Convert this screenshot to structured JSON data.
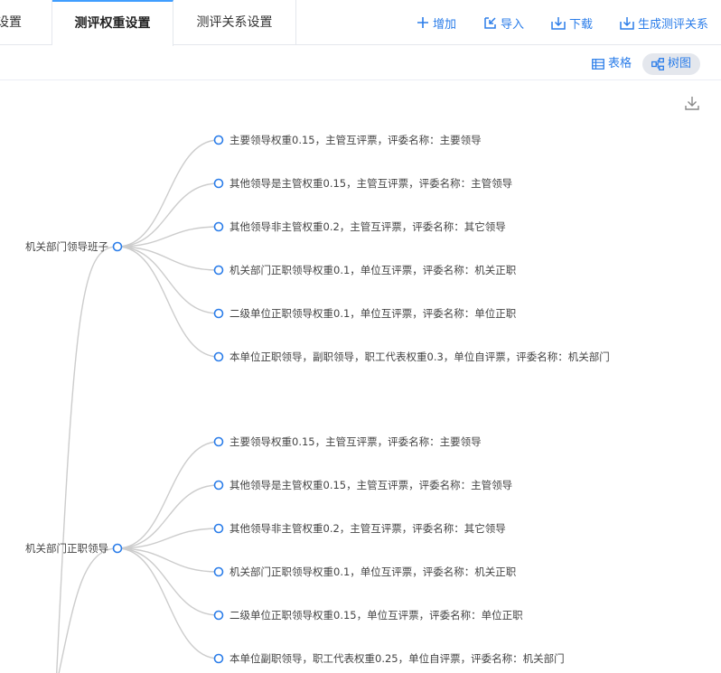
{
  "tabs": [
    {
      "label": "次设置"
    },
    {
      "label": "测评权重设置"
    },
    {
      "label": "测评关系设置"
    }
  ],
  "toolbar": {
    "add_label": "增加",
    "import_label": "导入",
    "download_label": "下载",
    "generate_label": "生成测评关系"
  },
  "view": {
    "table_label": "表格",
    "tree_label": "树图",
    "active": "tree"
  },
  "colors": {
    "accent": "#2b7de9",
    "node_stroke": "#2b7de9",
    "link": "#cccccc"
  },
  "tree": [
    {
      "name": "机关部门领导班子",
      "children": [
        "主要领导权重0.15，主管互评票，评委名称：主要领导",
        "其他领导是主管权重0.15，主管互评票，评委名称：主管领导",
        "其他领导非主管权重0.2，主管互评票，评委名称：其它领导",
        "机关部门正职领导权重0.1，单位互评票，评委名称：机关正职",
        "二级单位正职领导权重0.1，单位互评票，评委名称：单位正职",
        "本单位正职领导，副职领导，职工代表权重0.3，单位自评票，评委名称：机关部门"
      ]
    },
    {
      "name": "机关部门正职领导",
      "children": [
        "主要领导权重0.15，主管互评票，评委名称：主要领导",
        "其他领导是主管权重0.15，主管互评票，评委名称：主管领导",
        "其他领导非主管权重0.2，主管互评票，评委名称：其它领导",
        "机关部门正职领导权重0.1，单位互评票，评委名称：机关正职",
        "二级单位正职领导权重0.15，单位互评票，评委名称：单位正职",
        "本单位副职领导，职工代表权重0.25，单位自评票，评委名称：机关部门"
      ]
    }
  ]
}
